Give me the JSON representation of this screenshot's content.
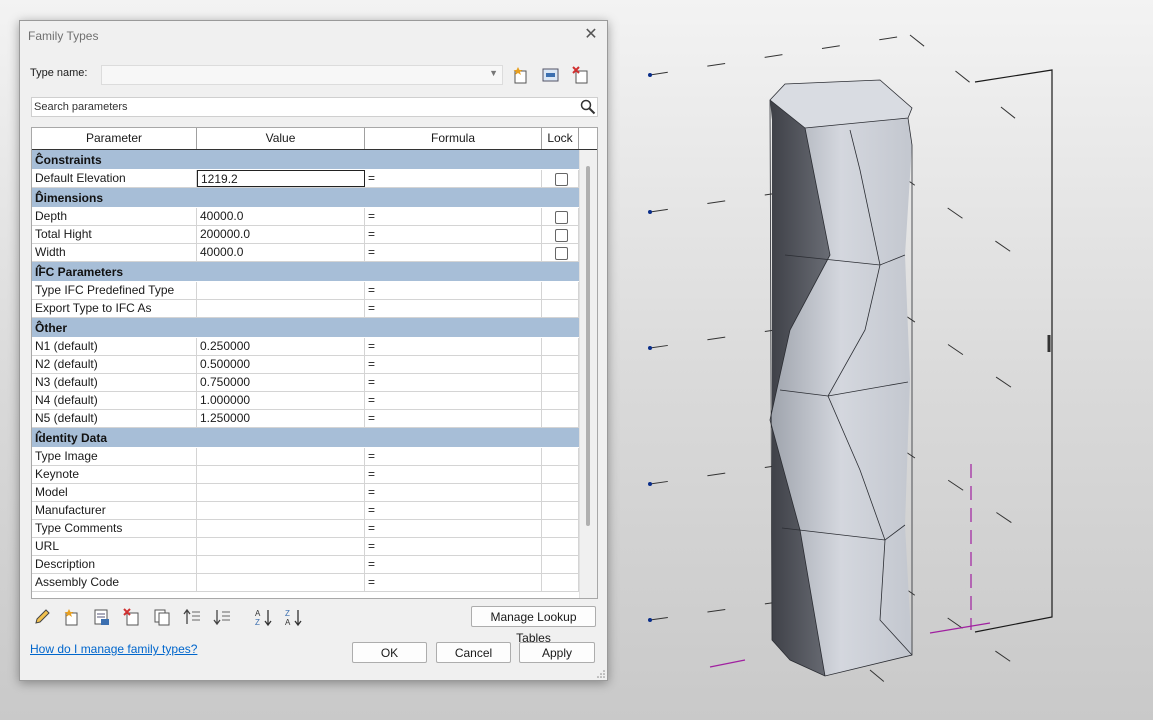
{
  "dialog": {
    "title": "Family Types",
    "type_name_label": "Type name:",
    "type_name_value": "",
    "search_placeholder": "Search parameters",
    "columns": [
      "Parameter",
      "Value",
      "Formula",
      "Lock"
    ],
    "groups": [
      {
        "name": "Constraints",
        "rows": [
          {
            "param": "Default Elevation",
            "value": "1219.2",
            "formula": "=",
            "lock": true,
            "active": true
          }
        ]
      },
      {
        "name": "Dimensions",
        "rows": [
          {
            "param": "Depth",
            "value": "40000.0",
            "formula": "=",
            "lock": true
          },
          {
            "param": "Total Hight",
            "value": "200000.0",
            "formula": "=",
            "lock": true
          },
          {
            "param": "Width",
            "value": "40000.0",
            "formula": "=",
            "lock": true
          }
        ]
      },
      {
        "name": "IFC Parameters",
        "rows": [
          {
            "param": "Type IFC Predefined Type",
            "value": "",
            "formula": "=",
            "lock": false
          },
          {
            "param": "Export Type to IFC As",
            "value": "",
            "formula": "=",
            "lock": false
          }
        ]
      },
      {
        "name": "Other",
        "rows": [
          {
            "param": "N1 (default)",
            "value": "0.250000",
            "formula": "=",
            "lock": false
          },
          {
            "param": "N2 (default)",
            "value": "0.500000",
            "formula": "=",
            "lock": false
          },
          {
            "param": "N3 (default)",
            "value": "0.750000",
            "formula": "=",
            "lock": false
          },
          {
            "param": "N4 (default)",
            "value": "1.000000",
            "formula": "=",
            "lock": false
          },
          {
            "param": "N5 (default)",
            "value": "1.250000",
            "formula": "=",
            "lock": false
          }
        ]
      },
      {
        "name": "Identity Data",
        "rows": [
          {
            "param": "Type Image",
            "value": "",
            "formula": "=",
            "lock": false
          },
          {
            "param": "Keynote",
            "value": "",
            "formula": "=",
            "lock": false
          },
          {
            "param": "Model",
            "value": "",
            "formula": "=",
            "lock": false
          },
          {
            "param": "Manufacturer",
            "value": "",
            "formula": "=",
            "lock": false
          },
          {
            "param": "Type Comments",
            "value": "",
            "formula": "=",
            "lock": false
          },
          {
            "param": "URL",
            "value": "",
            "formula": "=",
            "lock": false
          },
          {
            "param": "Description",
            "value": "",
            "formula": "=",
            "lock": false
          },
          {
            "param": "Assembly Code",
            "value": "",
            "formula": "=",
            "lock": false
          }
        ]
      }
    ],
    "manage_lookup_label": "Manage Lookup Tables",
    "help_link": "How do I manage family types?",
    "ok_label": "OK",
    "cancel_label": "Cancel",
    "apply_label": "Apply",
    "toolbar_icons": [
      "edit-pencil-icon",
      "new-parameter-icon",
      "parameter-properties-icon",
      "delete-parameter-icon",
      "copy-parameter-icon",
      "move-up-icon",
      "move-down-icon",
      "sort-ascending-icon",
      "sort-descending-icon"
    ],
    "type_icons": [
      "new-type-icon",
      "rename-type-icon",
      "delete-type-icon"
    ]
  },
  "colors": {
    "group_header": "#a7bed7",
    "reference_plane": "#0a2e8a",
    "section_line": "#a020a0"
  }
}
